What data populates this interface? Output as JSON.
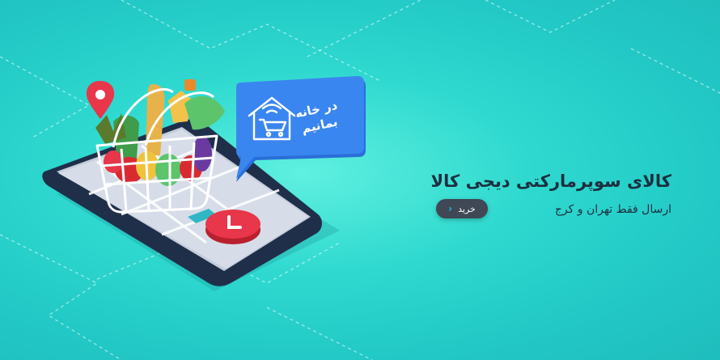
{
  "banner": {
    "headline": "کالای سوپرمارکتی دیجی کالا",
    "subline": "ارسال فقط تهران و کرج",
    "cta_label": "خرید"
  },
  "badge": {
    "line1": "در خانه",
    "line2": "بمانیم"
  },
  "colors": {
    "background": "#2fd9cf",
    "headline": "#1d2f3f",
    "cta_bg": "#3f4854",
    "cta_chevron": "#2bb5e6",
    "badge_bg": "#3a86f0",
    "phone_frame": "#1f2f4a",
    "map_pin": "#e8364a"
  },
  "icons": {
    "cta": "chevron-left-icon",
    "badge": "home-wifi-cart-icon",
    "pin": "map-pin-icon",
    "phone_button": "clock-button-icon"
  }
}
